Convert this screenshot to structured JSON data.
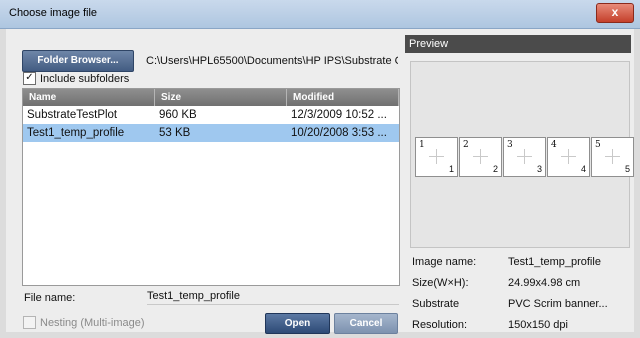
{
  "window": {
    "title": "Choose image file",
    "close_label": "x"
  },
  "toolbar": {
    "folder_button_label": "Folder Browser...",
    "path": "C:\\Users\\HPL65500\\Documents\\HP IPS\\Substrate Cr",
    "include_subfolders_label": "Include subfolders",
    "include_subfolders_checked": true
  },
  "file_list": {
    "columns": [
      "Name",
      "Size",
      "Modified"
    ],
    "rows": [
      {
        "name": "SubstrateTestPlot",
        "size": "960 KB",
        "modified": "12/3/2009 10:52 ...",
        "selected": false
      },
      {
        "name": "Test1_temp_profile",
        "size": "53 KB",
        "modified": "10/20/2008 3:53 ...",
        "selected": true
      }
    ]
  },
  "filename": {
    "label": "File name:",
    "value": "Test1_temp_profile"
  },
  "nesting": {
    "label": "Nesting (Multi-image)",
    "checked": false,
    "enabled": false
  },
  "buttons": {
    "open_label": "Open",
    "cancel_label": "Cancel"
  },
  "preview": {
    "header": "Preview",
    "thumbs": [
      {
        "tl": "1",
        "br": "1"
      },
      {
        "tl": "2",
        "br": "2"
      },
      {
        "tl": "3",
        "br": "3"
      },
      {
        "tl": "4",
        "br": "4"
      },
      {
        "tl": "5",
        "br": "5"
      }
    ],
    "info": [
      {
        "label": "Image name:",
        "value": "Test1_temp_profile"
      },
      {
        "label": "Size(W×H):",
        "value": "24.99x4.98 cm"
      },
      {
        "label": "Substrate",
        "value": "PVC Scrim banner..."
      },
      {
        "label": "Resolution:",
        "value": "150x150 dpi"
      }
    ]
  },
  "colors": {
    "title_bar": "#aec6e0",
    "selection": "#9fc8ef",
    "preview_header": "#4b4b4b",
    "primary_button": "#2d4a76"
  }
}
